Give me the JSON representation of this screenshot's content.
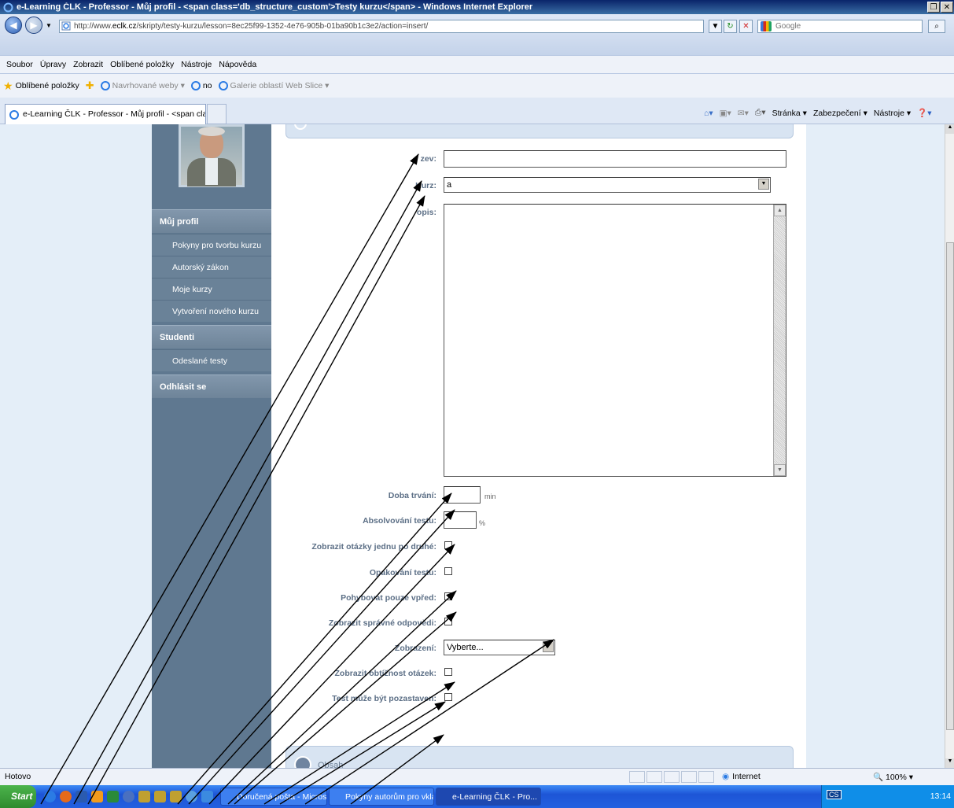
{
  "window": {
    "title": "e-Learning ČLK - Professor - Můj profil - <span class='db_structure_custom'>Testy kurzu</span> - Windows Internet Explorer"
  },
  "address": {
    "domain_prefix": "http://www.",
    "domain": "eclk.cz",
    "path": "/skripty/testy-kurzu/lesson=8ec25f99-1352-4e76-905b-01ba90b1c3e2/action=insert/"
  },
  "search": {
    "placeholder": "Google"
  },
  "menu": [
    "Soubor",
    "Úpravy",
    "Zobrazit",
    "Oblíbené položky",
    "Nástroje",
    "Nápověda"
  ],
  "favorites": {
    "label": "Oblíbené položky",
    "items": [
      "Navrhované weby ▾",
      "no",
      "Galerie oblastí Web Slice ▾"
    ]
  },
  "tab": {
    "label": "e-Learning ČLK - Professor - Můj profil - <span class='db..."
  },
  "commandbar": [
    "Stránka ▾",
    "Zabezpečení ▾",
    "Nástroje ▾"
  ],
  "sidebar": {
    "sections": [
      {
        "label": "Můj profil",
        "items": [
          "Pokyny pro tvorbu kurzu",
          "Autorský zákon",
          "Moje kurzy",
          "Vytvoření nového kurzu"
        ]
      },
      {
        "label": "Studenti",
        "items": [
          "Odeslané testy"
        ]
      },
      {
        "label": "Odhlásit se",
        "items": []
      }
    ]
  },
  "form": {
    "nazev": {
      "label": "zev:",
      "value": ""
    },
    "kurz": {
      "label": "Kurz:",
      "value": "a"
    },
    "popis": {
      "label": "opis:",
      "value": ""
    },
    "doba": {
      "label": "Doba trvání:",
      "unit": "min",
      "value": ""
    },
    "absolvovani": {
      "label": "Absolvování testu:",
      "unit": "%",
      "value": ""
    },
    "checkboxes": [
      {
        "label": "Zobrazit otázky jednu po druhé:",
        "checked": false
      },
      {
        "label": "Opakování testu:",
        "checked": false
      },
      {
        "label": "Pohybovat pouze vpřed:",
        "checked": false
      },
      {
        "label": "Zobrazit správné odpovědi:",
        "checked": false
      }
    ],
    "zobrazeni": {
      "label": "Zobrazení:",
      "value": "Vyberte..."
    },
    "checkboxes2": [
      {
        "label": "Zobrazit obtížnost otázek:",
        "checked": false
      },
      {
        "label": "Test může být pozastaven:",
        "checked": false
      }
    ]
  },
  "bottom_panel": {
    "label": "Obsah"
  },
  "status": {
    "text": "Hotovo",
    "zone": "Internet",
    "zoom": "100%"
  },
  "taskbar": {
    "start": "Start",
    "tasks": [
      "Doručená pošta - Microso...",
      "Pokyny autorům pro vklád...",
      "e-Learning ČLK - Pro..."
    ],
    "lang": "CS",
    "time": "13:14"
  },
  "colors": {
    "sidebar": "#5f7890",
    "page_bg": "#e4eef8",
    "label": "#5c6f86",
    "arrow": "#000000"
  }
}
